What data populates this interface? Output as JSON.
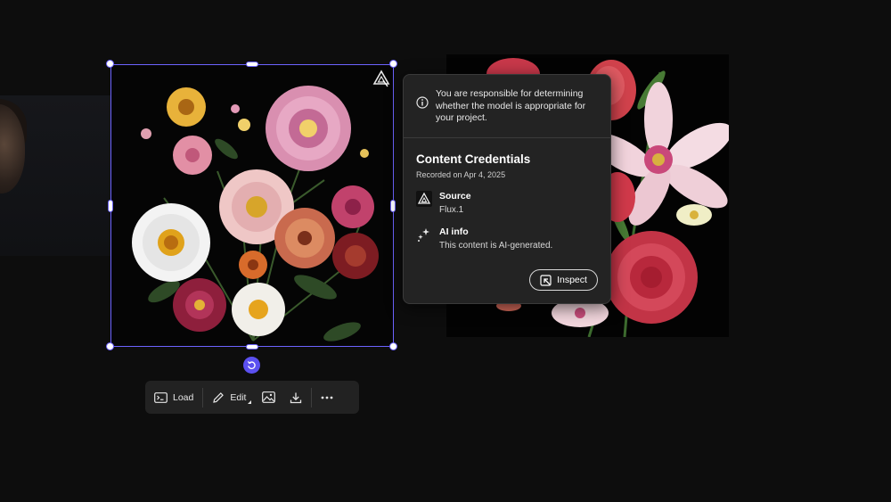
{
  "popup": {
    "warning_text": "You are responsible for determining whether the model is appropriate for your project.",
    "title": "Content Credentials",
    "recorded": "Recorded on Apr 4, 2025",
    "source": {
      "label": "Source",
      "value": "Flux.1"
    },
    "ai_info": {
      "label": "AI info",
      "value": "This content is AI-generated."
    },
    "inspect_label": "Inspect"
  },
  "toolbar": {
    "load_label": "Load",
    "edit_label": "Edit"
  },
  "icons": {
    "info": "info-icon",
    "source": "adobe-content-credentials-icon",
    "ai": "sparkle-icon",
    "inspect": "inspect-icon",
    "load": "terminal-icon",
    "edit": "pencil-icon",
    "image": "image-icon",
    "download": "download-icon",
    "more": "more-icon",
    "rotate": "rotate-icon"
  },
  "colors": {
    "selection": "#6c63ff",
    "panel_bg": "#232323",
    "background": "#0d0d0d"
  }
}
